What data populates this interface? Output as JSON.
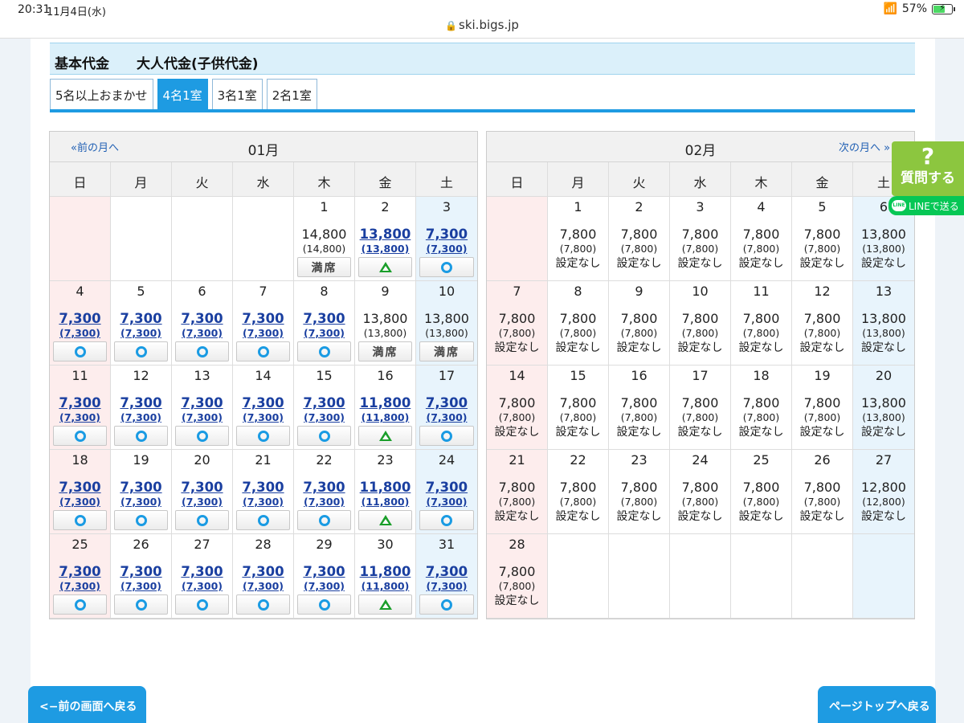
{
  "status": {
    "time": "20:31",
    "date": "11月4日(水)",
    "url": "ski.bigs.jp",
    "battery": "57%"
  },
  "header": {
    "price_label": "基本代金　　大人代金(子供代金)"
  },
  "tabs": [
    {
      "label": "5名以上おまかせ",
      "active": false
    },
    {
      "label": "4名1室",
      "active": true
    },
    {
      "label": "3名1室",
      "active": false
    },
    {
      "label": "2名1室",
      "active": false
    }
  ],
  "weekdays": [
    "日",
    "月",
    "火",
    "水",
    "木",
    "金",
    "土"
  ],
  "calendars": [
    {
      "title": "01月",
      "prev": "«前の月へ",
      "next": "",
      "offset": 4,
      "days": [
        {
          "d": "1",
          "p": "14,800",
          "c": "(14,800)",
          "s": "full"
        },
        {
          "d": "2",
          "p": "13,800",
          "c": "(13,800)",
          "s": "tri",
          "link": true
        },
        {
          "d": "3",
          "p": "7,300",
          "c": "(7,300)",
          "s": "circle",
          "link": true
        },
        {
          "d": "4",
          "p": "7,300",
          "c": "(7,300)",
          "s": "circle",
          "link": true
        },
        {
          "d": "5",
          "p": "7,300",
          "c": "(7,300)",
          "s": "circle",
          "link": true
        },
        {
          "d": "6",
          "p": "7,300",
          "c": "(7,300)",
          "s": "circle",
          "link": true
        },
        {
          "d": "7",
          "p": "7,300",
          "c": "(7,300)",
          "s": "circle",
          "link": true
        },
        {
          "d": "8",
          "p": "7,300",
          "c": "(7,300)",
          "s": "circle",
          "link": true
        },
        {
          "d": "9",
          "p": "13,800",
          "c": "(13,800)",
          "s": "full"
        },
        {
          "d": "10",
          "p": "13,800",
          "c": "(13,800)",
          "s": "full"
        },
        {
          "d": "11",
          "p": "7,300",
          "c": "(7,300)",
          "s": "circle",
          "link": true
        },
        {
          "d": "12",
          "p": "7,300",
          "c": "(7,300)",
          "s": "circle",
          "link": true
        },
        {
          "d": "13",
          "p": "7,300",
          "c": "(7,300)",
          "s": "circle",
          "link": true
        },
        {
          "d": "14",
          "p": "7,300",
          "c": "(7,300)",
          "s": "circle",
          "link": true
        },
        {
          "d": "15",
          "p": "7,300",
          "c": "(7,300)",
          "s": "circle",
          "link": true
        },
        {
          "d": "16",
          "p": "11,800",
          "c": "(11,800)",
          "s": "tri",
          "link": true
        },
        {
          "d": "17",
          "p": "7,300",
          "c": "(7,300)",
          "s": "circle",
          "link": true
        },
        {
          "d": "18",
          "p": "7,300",
          "c": "(7,300)",
          "s": "circle",
          "link": true
        },
        {
          "d": "19",
          "p": "7,300",
          "c": "(7,300)",
          "s": "circle",
          "link": true
        },
        {
          "d": "20",
          "p": "7,300",
          "c": "(7,300)",
          "s": "circle",
          "link": true
        },
        {
          "d": "21",
          "p": "7,300",
          "c": "(7,300)",
          "s": "circle",
          "link": true
        },
        {
          "d": "22",
          "p": "7,300",
          "c": "(7,300)",
          "s": "circle",
          "link": true
        },
        {
          "d": "23",
          "p": "11,800",
          "c": "(11,800)",
          "s": "tri",
          "link": true
        },
        {
          "d": "24",
          "p": "7,300",
          "c": "(7,300)",
          "s": "circle",
          "link": true
        },
        {
          "d": "25",
          "p": "7,300",
          "c": "(7,300)",
          "s": "circle",
          "link": true
        },
        {
          "d": "26",
          "p": "7,300",
          "c": "(7,300)",
          "s": "circle",
          "link": true
        },
        {
          "d": "27",
          "p": "7,300",
          "c": "(7,300)",
          "s": "circle",
          "link": true
        },
        {
          "d": "28",
          "p": "7,300",
          "c": "(7,300)",
          "s": "circle",
          "link": true
        },
        {
          "d": "29",
          "p": "7,300",
          "c": "(7,300)",
          "s": "circle",
          "link": true
        },
        {
          "d": "30",
          "p": "11,800",
          "c": "(11,800)",
          "s": "tri",
          "link": true
        },
        {
          "d": "31",
          "p": "7,300",
          "c": "(7,300)",
          "s": "circle",
          "link": true
        }
      ]
    },
    {
      "title": "02月",
      "prev": "",
      "next": "次の月へ »",
      "offset": 1,
      "days": [
        {
          "d": "1",
          "p": "7,800",
          "c": "(7,800)",
          "t": "設定なし"
        },
        {
          "d": "2",
          "p": "7,800",
          "c": "(7,800)",
          "t": "設定なし"
        },
        {
          "d": "3",
          "p": "7,800",
          "c": "(7,800)",
          "t": "設定なし"
        },
        {
          "d": "4",
          "p": "7,800",
          "c": "(7,800)",
          "t": "設定なし"
        },
        {
          "d": "5",
          "p": "7,800",
          "c": "(7,800)",
          "t": "設定なし"
        },
        {
          "d": "6",
          "p": "13,800",
          "c": "(13,800)",
          "t": "設定なし"
        },
        {
          "d": "7",
          "p": "7,800",
          "c": "(7,800)",
          "t": "設定なし"
        },
        {
          "d": "8",
          "p": "7,800",
          "c": "(7,800)",
          "t": "設定なし"
        },
        {
          "d": "9",
          "p": "7,800",
          "c": "(7,800)",
          "t": "設定なし"
        },
        {
          "d": "10",
          "p": "7,800",
          "c": "(7,800)",
          "t": "設定なし"
        },
        {
          "d": "11",
          "p": "7,800",
          "c": "(7,800)",
          "t": "設定なし"
        },
        {
          "d": "12",
          "p": "7,800",
          "c": "(7,800)",
          "t": "設定なし"
        },
        {
          "d": "13",
          "p": "13,800",
          "c": "(13,800)",
          "t": "設定なし"
        },
        {
          "d": "14",
          "p": "7,800",
          "c": "(7,800)",
          "t": "設定なし"
        },
        {
          "d": "15",
          "p": "7,800",
          "c": "(7,800)",
          "t": "設定なし"
        },
        {
          "d": "16",
          "p": "7,800",
          "c": "(7,800)",
          "t": "設定なし"
        },
        {
          "d": "17",
          "p": "7,800",
          "c": "(7,800)",
          "t": "設定なし"
        },
        {
          "d": "18",
          "p": "7,800",
          "c": "(7,800)",
          "t": "設定なし"
        },
        {
          "d": "19",
          "p": "7,800",
          "c": "(7,800)",
          "t": "設定なし"
        },
        {
          "d": "20",
          "p": "13,800",
          "c": "(13,800)",
          "t": "設定なし"
        },
        {
          "d": "21",
          "p": "7,800",
          "c": "(7,800)",
          "t": "設定なし"
        },
        {
          "d": "22",
          "p": "7,800",
          "c": "(7,800)",
          "t": "設定なし"
        },
        {
          "d": "23",
          "p": "7,800",
          "c": "(7,800)",
          "t": "設定なし"
        },
        {
          "d": "24",
          "p": "7,800",
          "c": "(7,800)",
          "t": "設定なし"
        },
        {
          "d": "25",
          "p": "7,800",
          "c": "(7,800)",
          "t": "設定なし"
        },
        {
          "d": "26",
          "p": "7,800",
          "c": "(7,800)",
          "t": "設定なし"
        },
        {
          "d": "27",
          "p": "12,800",
          "c": "(12,800)",
          "t": "設定なし"
        },
        {
          "d": "28",
          "p": "7,800",
          "c": "(7,800)",
          "t": "設定なし"
        }
      ]
    }
  ],
  "availability": {
    "full": "満席"
  },
  "widgets": {
    "question_mark": "?",
    "question_label": "質問する",
    "line_label": "LINEで送る",
    "line_icon": "LINE"
  },
  "footer": {
    "back": "<−前の画面へ戻る",
    "top": "ページトップへ戻る"
  }
}
